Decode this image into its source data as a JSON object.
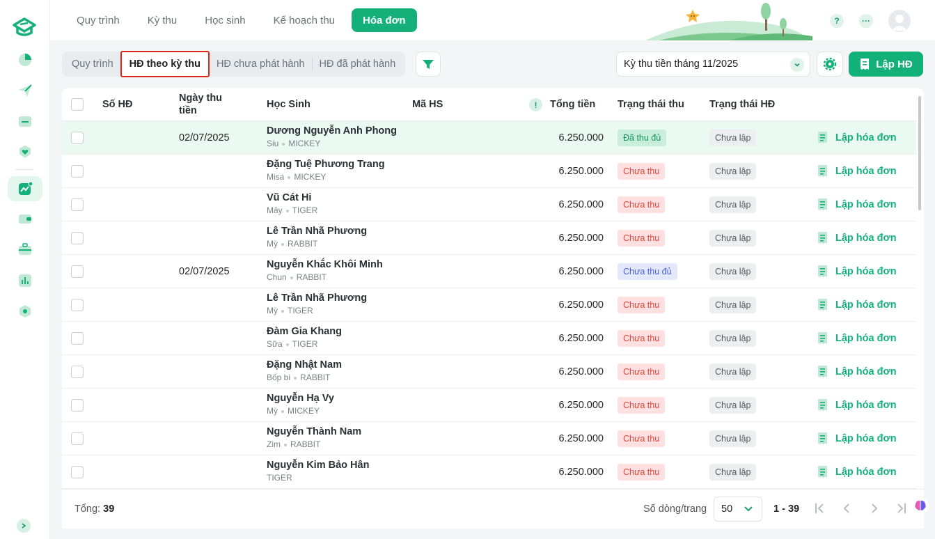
{
  "top_nav": {
    "tabs": [
      {
        "label": "Quy trình",
        "active": false
      },
      {
        "label": "Kỳ thu",
        "active": false
      },
      {
        "label": "Học sinh",
        "active": false
      },
      {
        "label": "Kế hoạch thu",
        "active": false
      },
      {
        "label": "Hóa đơn",
        "active": true
      }
    ],
    "help_icon": "?",
    "more_icon": "···"
  },
  "sub_tabs": [
    {
      "label": "Quy trình",
      "selected": false
    },
    {
      "label": "HĐ theo kỳ thu",
      "selected": true
    },
    {
      "label": "HĐ chưa phát hành",
      "selected": false
    },
    {
      "label": "HĐ đã phát hành",
      "selected": false
    }
  ],
  "period_select": {
    "value": "Kỳ thu tiền tháng 11/2025"
  },
  "create_button": {
    "label": "Lập HĐ"
  },
  "table": {
    "headers": {
      "so_hd": "Số HĐ",
      "ngay_thu_1": "Ngày thu",
      "ngay_thu_2": "tiền",
      "hoc_sinh": "Học Sinh",
      "ma_hs": "Mã HS",
      "info": "!",
      "tong_tien": "Tổng tiền",
      "trang_thai_thu": "Trạng thái thu",
      "trang_thai_hd": "Trạng thái HĐ"
    },
    "rows": [
      {
        "date": "02/07/2025",
        "name": "Dương Nguyễn Anh Phong",
        "nick": "Siu",
        "cls": "MICKEY",
        "amount": "6.250.000",
        "pay_status": "Đã thu đủ",
        "pay_kind": "done",
        "inv_status": "Chưa lập",
        "action": "Lập hóa đơn",
        "highlight": true
      },
      {
        "date": "",
        "name": "Đặng Tuệ Phương Trang",
        "nick": "Misa",
        "cls": "MICKEY",
        "amount": "6.250.000",
        "pay_status": "Chưa thu",
        "pay_kind": "no",
        "inv_status": "Chưa lập",
        "action": "Lập hóa đơn"
      },
      {
        "date": "",
        "name": "Vũ Cát Hi",
        "nick": "Mây",
        "cls": "TIGER",
        "amount": "6.250.000",
        "pay_status": "Chưa thu",
        "pay_kind": "no",
        "inv_status": "Chưa lập",
        "action": "Lập hóa đơn"
      },
      {
        "date": "",
        "name": "Lê Trần Nhã Phương",
        "nick": "Mỳ",
        "cls": "RABBIT",
        "amount": "6.250.000",
        "pay_status": "Chưa thu",
        "pay_kind": "no",
        "inv_status": "Chưa lập",
        "action": "Lập hóa đơn"
      },
      {
        "date": "02/07/2025",
        "name": "Nguyễn Khắc Khôi Minh",
        "nick": "Chun",
        "cls": "RABBIT",
        "amount": "6.250.000",
        "pay_status": "Chưa thu đủ",
        "pay_kind": "part",
        "inv_status": "Chưa lập",
        "action": "Lập hóa đơn"
      },
      {
        "date": "",
        "name": "Lê Trần Nhã Phương",
        "nick": "Mỳ",
        "cls": "TIGER",
        "amount": "6.250.000",
        "pay_status": "Chưa thu",
        "pay_kind": "no",
        "inv_status": "Chưa lập",
        "action": "Lập hóa đơn"
      },
      {
        "date": "",
        "name": "Đàm Gia Khang",
        "nick": "Sữa",
        "cls": "TIGER",
        "amount": "6.250.000",
        "pay_status": "Chưa thu",
        "pay_kind": "no",
        "inv_status": "Chưa lập",
        "action": "Lập hóa đơn"
      },
      {
        "date": "",
        "name": "Đặng Nhật Nam",
        "nick": "Bốp bi",
        "cls": "RABBIT",
        "amount": "6.250.000",
        "pay_status": "Chưa thu",
        "pay_kind": "no",
        "inv_status": "Chưa lập",
        "action": "Lập hóa đơn"
      },
      {
        "date": "",
        "name": "Nguyễn Hạ Vy",
        "nick": "Mỳ",
        "cls": "MICKEY",
        "amount": "6.250.000",
        "pay_status": "Chưa thu",
        "pay_kind": "no",
        "inv_status": "Chưa lập",
        "action": "Lập hóa đơn"
      },
      {
        "date": "",
        "name": "Nguyễn Thành Nam",
        "nick": "Zim",
        "cls": "RABBIT",
        "amount": "6.250.000",
        "pay_status": "Chưa thu",
        "pay_kind": "no",
        "inv_status": "Chưa lập",
        "action": "Lập hóa đơn"
      },
      {
        "date": "",
        "name": "Nguyễn Kim Bảo Hân",
        "nick": "",
        "cls": "TIGER",
        "amount": "6.250.000",
        "pay_status": "Chưa thu",
        "pay_kind": "no",
        "inv_status": "Chưa lập",
        "action": "Lập hóa đơn"
      }
    ]
  },
  "footer": {
    "total_label": "Tổng:",
    "total_value": "39",
    "rows_per_page_label": "Số dòng/trang",
    "rows_per_page_value": "50",
    "range": "1 - 39"
  },
  "colors": {
    "accent": "#14b07a",
    "selected_outline": "#e0251b"
  }
}
